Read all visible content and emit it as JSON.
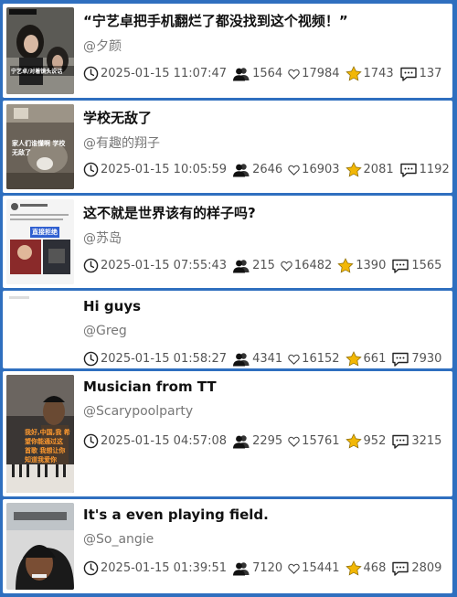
{
  "feed": {
    "items": [
      {
        "title": "“宁艺卓把手机翻烂了都没找到这个视频！”",
        "author": "@夕颜",
        "time": "2025-01-15 11:07:47",
        "followers": "1564",
        "likes": "17984",
        "favorites": "1743",
        "comments": "137"
      },
      {
        "title": "学校无敌了",
        "author": "@有趣的翔子",
        "time": "2025-01-15 10:05:59",
        "followers": "2646",
        "likes": "16903",
        "favorites": "2081",
        "comments": "1192"
      },
      {
        "title": "这不就是世界该有的样子吗?",
        "author": "@苏岛",
        "time": "2025-01-15 07:55:43",
        "followers": "215",
        "likes": "16482",
        "favorites": "1390",
        "comments": "1565"
      },
      {
        "title": "Hi guys",
        "author": "@Greg",
        "time": "2025-01-15 01:58:27",
        "followers": "4341",
        "likes": "16152",
        "favorites": "661",
        "comments": "7930"
      },
      {
        "title": "Musician from TT",
        "author": "@Scarypoolparty",
        "time": "2025-01-15 04:57:08",
        "followers": "2295",
        "likes": "15761",
        "favorites": "952",
        "comments": "3215"
      },
      {
        "title": "It's a even playing field.",
        "author": "@So_angie",
        "time": "2025-01-15 01:39:51",
        "followers": "7120",
        "likes": "15441",
        "favorites": "468",
        "comments": "2809"
      }
    ]
  },
  "thumbnails": {
    "item1_caption": "宁艺卓/对着镜头说话",
    "item2_caption": "家人们谁懂啊 学校无敌了",
    "item3_label": "直接拒绝",
    "item5_caption": "我好,中国,我 希望你能通过这 首歌 我想让你 知道我爱你"
  },
  "icons": {
    "clock": "clock-icon",
    "followers": "followers-icon",
    "like": "heart-icon",
    "favorite": "star-icon",
    "comment": "comment-icon"
  },
  "colors": {
    "background": "#2f6fbf",
    "card": "#ffffff",
    "star": "#f2b705"
  }
}
